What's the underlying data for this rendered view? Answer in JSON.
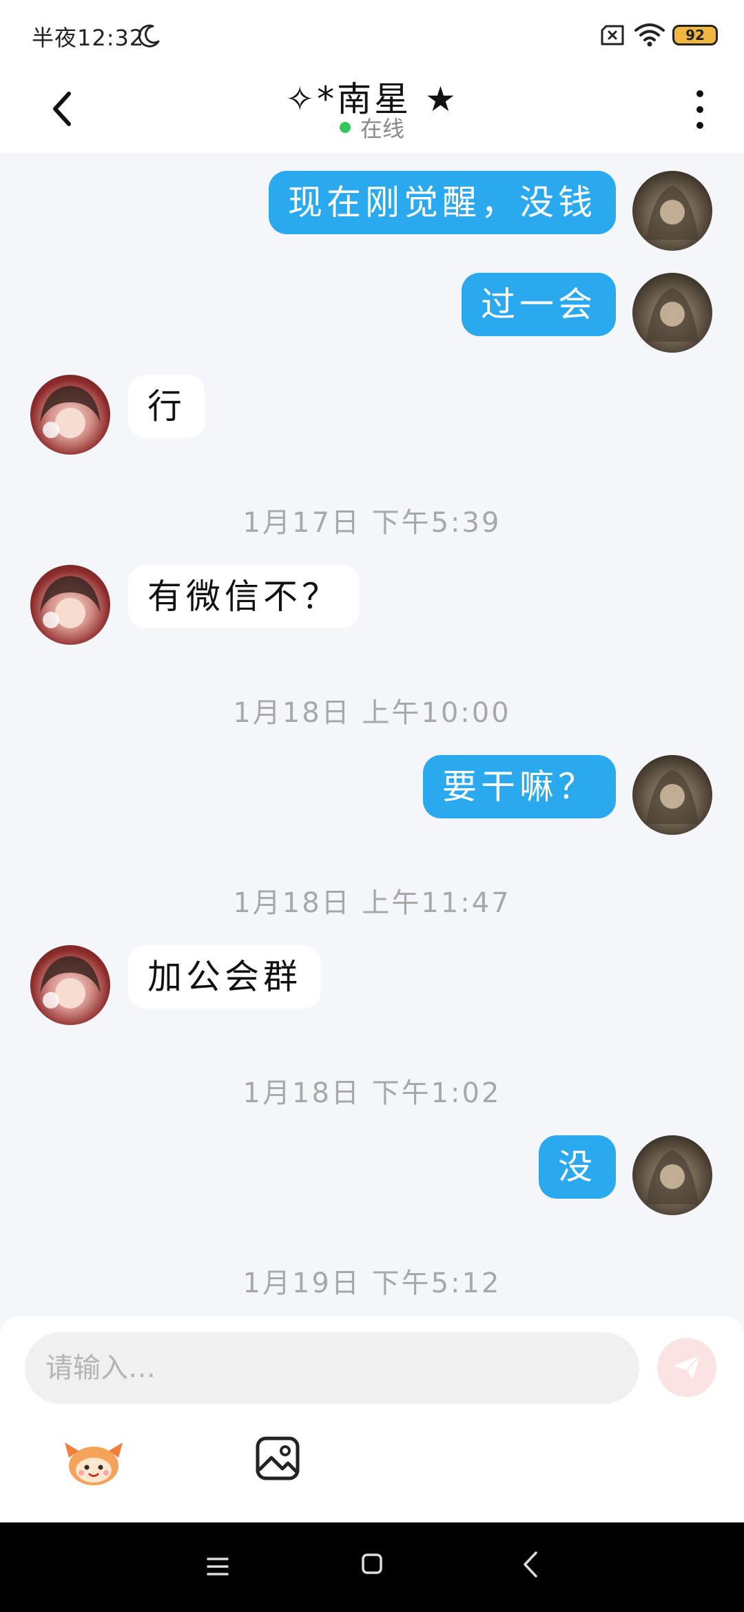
{
  "status_bar": {
    "time": "半夜12:32",
    "battery": "92",
    "icons": [
      "moon-icon",
      "sim-x-icon",
      "wifi-icon",
      "battery-icon"
    ]
  },
  "header": {
    "title": "✧*南星 ★",
    "online_status": "在线",
    "online_color": "#35c759"
  },
  "messages": [
    {
      "side": "out",
      "text": "现在刚觉醒，没钱"
    },
    {
      "side": "out",
      "text": "过一会"
    },
    {
      "side": "in",
      "text": "行"
    },
    {
      "type": "timestamp",
      "text": "1月17日 下午5:39"
    },
    {
      "side": "in",
      "text": "有微信不？"
    },
    {
      "type": "timestamp",
      "text": "1月18日 上午10:00"
    },
    {
      "side": "out",
      "text": "要干嘛？"
    },
    {
      "type": "timestamp",
      "text": "1月18日 上午11:47"
    },
    {
      "side": "in",
      "text": "加公会群"
    },
    {
      "type": "timestamp",
      "text": "1月18日 下午1:02"
    },
    {
      "side": "out",
      "text": "没"
    },
    {
      "type": "timestamp",
      "text": "1月19日 下午5:12"
    }
  ],
  "composer": {
    "placeholder": "请输入…",
    "value": "",
    "icons": [
      "send-icon",
      "mascot-emoji-icon",
      "image-icon"
    ]
  },
  "colors": {
    "outgoing_bubble": "#2ba9ef",
    "incoming_bubble": "#ffffff",
    "chat_background": "#f4f6f9",
    "send_button": "#fbe3e3"
  },
  "nav_bar": {
    "icons": [
      "menu-icon",
      "home-icon",
      "back-icon"
    ]
  }
}
